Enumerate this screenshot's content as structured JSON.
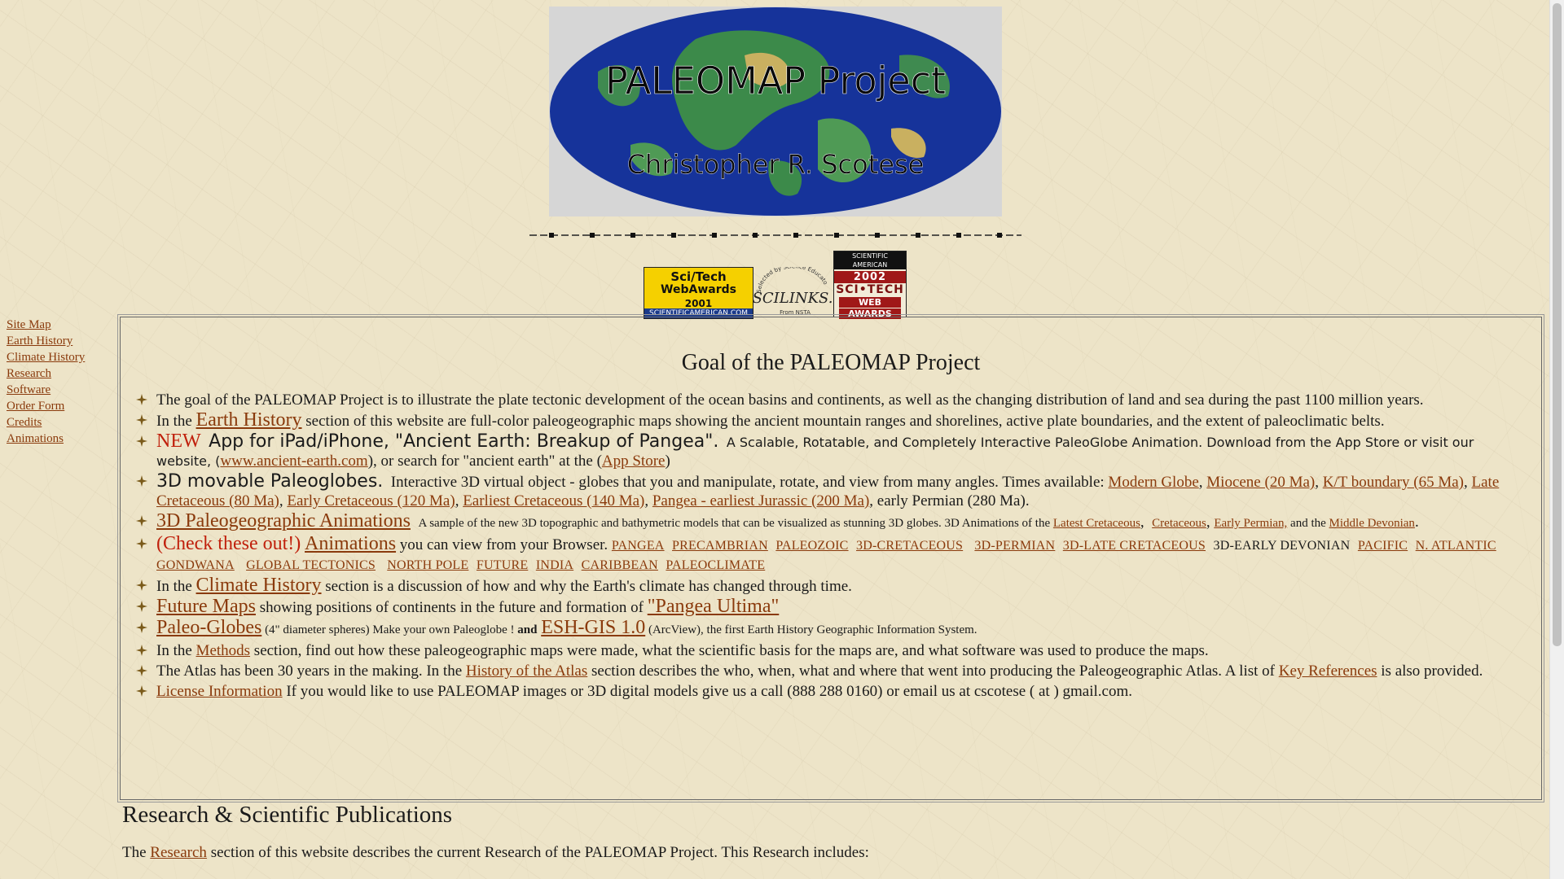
{
  "header": {
    "logo_title": "PALEOMAP Project",
    "logo_author": "Christopher R. Scotese"
  },
  "awards": {
    "sci_tech_2001": {
      "line1": "Sci/Tech",
      "line2": "WebAwards",
      "line3": "2001",
      "footer": "SCIENTIFICAMERICAN.COM"
    },
    "scilinks": {
      "top": "Selected by Science Educators",
      "name": "SCILINKS.",
      "sub": "From NSTA"
    },
    "sci_tech_2002": {
      "header": "SCIENTIFIC AMERICAN",
      "year": "2002",
      "name": "SCI•TECH",
      "web": "WEB",
      "awards": "AWARDS"
    }
  },
  "sidebar": {
    "items": [
      {
        "label": "Site Map"
      },
      {
        "label": "Earth History"
      },
      {
        "label": "Climate History"
      },
      {
        "label": "Research"
      },
      {
        "label": "Software"
      },
      {
        "label": "Order Form"
      },
      {
        "label": "Credits"
      },
      {
        "label": "Animations"
      }
    ]
  },
  "goal": {
    "title": "Goal of the PALEOMAP Project",
    "p1": "The goal of the PALEOMAP Project is to illustrate the plate tectonic development of the ocean basins and continents, as well as the changing distribution of land and sea during the past 1100 million years.",
    "p2_pre": "In the ",
    "p2_link": "Earth History",
    "p2_post": " section of this website are full-color paleogeographic maps showing the ancient mountain ranges and shorelines, active plate boundaries, and the extent of paleoclimatic belts.",
    "p3_new": "NEW",
    "p3_app": "App for iPad/iPhone, \"Ancient Earth: Breakup of Pangea\".",
    "p3_desc": "A Scalable, Rotatable, and Completely Interactive PaleoGlobe Animation. Download from the App Store or visit our website, (",
    "p3_link1": "www.ancient-earth.com",
    "p3_mid": "), or search for \"ancient earth\" at the (",
    "p3_link2": "App Store",
    "p3_end": ")",
    "p4_head": "3D movable Paleoglobes.",
    "p4_desc": "Interactive 3D virtual object - globes that you and manipulate, rotate, and view from many angles.  Times available: ",
    "p4_links": [
      "Modern Globe",
      "Miocene (20 Ma)",
      "K/T boundary (65 Ma)",
      "Late Cretaceous (80 Ma)",
      "Early Cretaceous (120 Ma)",
      "Earliest Cretaceous (140 Ma)",
      "Pangea - earliest Jurassic (200 Ma)"
    ],
    "p4_end": ", early Permian (280 Ma).",
    "p5_link": "3D Paleogeographic Animations",
    "p5_desc": "A sample of the new 3D topographic and bathymetric models that can be visualized as stunning 3D globes.  3D Animations of the ",
    "p5_links": [
      "Latest Cretaceous",
      "Cretaceous",
      "Early Permian,"
    ],
    "p5_and": " and the ",
    "p5_last": "Middle Devonian",
    "p6_check": "(Check these out!)",
    "p6_link": "Animations",
    "p6_desc": " you can view from your Browser.",
    "p6_items": [
      "PANGEA",
      "PRECAMBRIAN",
      "PALEOZOIC",
      "3D-CRETACEOUS",
      "3D-PERMIAN",
      "3D-LATE CRETACEOUS"
    ],
    "p6_plain": "3D-EARLY DEVONIAN",
    "p6_items2": [
      "PACIFIC",
      "N. ATLANTIC",
      "GONDWANA",
      "GLOBAL TECTONICS",
      "NORTH POLE",
      "FUTURE",
      "INDIA",
      "CARIBBEAN",
      "PALEOCLIMATE"
    ],
    "p7_pre": "In the ",
    "p7_link": "Climate History",
    "p7_post": " section is a discussion of how and why the Earth's climate has changed through time.",
    "p8_link": "Future Maps",
    "p8_mid": " showing positions of continents in the future and formation of ",
    "p8_link2": "\"Pangea Ultima\"",
    "p9_link": "Paleo-Globes",
    "p9_mid": " (4\" diameter spheres)  Make your own Paleoglobe ! ",
    "p9_and": "and",
    "p9_link2": "ESH-GIS 1.0",
    "p9_end": " (ArcView), the first Earth History Geographic Information System.",
    "p10_pre": "In the ",
    "p10_link": "Methods",
    "p10_post": " section, find out how these paleogeographic maps were made, what the scientific basis for the maps are, and what software was used to produce the maps.",
    "p11_pre": "The Atlas has been 30 years in the making.  In the ",
    "p11_link": "History of the Atlas",
    "p11_mid": " section describes the who, when, what and where that went into producing the Paleogeographic Atlas. A  list of ",
    "p11_link2": "Key References",
    "p11_end": " is also provided.",
    "p12_link": "License Information",
    "p12_post": "  If you would like to use PALEOMAP images or 3D digital models give us a call  (888 288 0160) or email  us at cscotese ( at ) gmail.com."
  },
  "research": {
    "title": "Research & Scientific Publications",
    "pre": "The ",
    "link": "Research",
    "post": " section of this website describes the current Research of the  PALEOMAP Project.  This Research includes:"
  },
  "colors": {
    "link": "#8a3a0c",
    "new": "#c0200c",
    "background": "#ede4c8"
  }
}
